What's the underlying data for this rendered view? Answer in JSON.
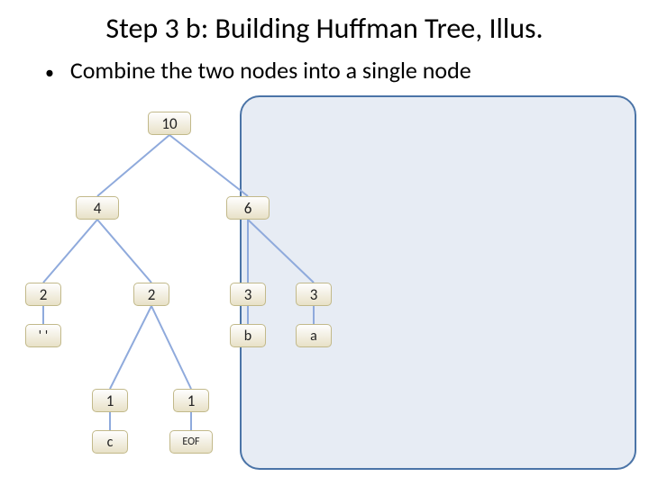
{
  "title": "Step 3 b: Building Huffman Tree, Illus.",
  "bullet": "Combine the two nodes into a single node",
  "nodes": {
    "root": "10",
    "l4": "4",
    "r6": "6",
    "ll2": "2",
    "lr2": "2",
    "rl3": "3",
    "rr3": "3",
    "sp": "' '",
    "b": "b",
    "a": "a",
    "c1": "1",
    "e1": "1",
    "c": "c",
    "eof": "EOF"
  }
}
